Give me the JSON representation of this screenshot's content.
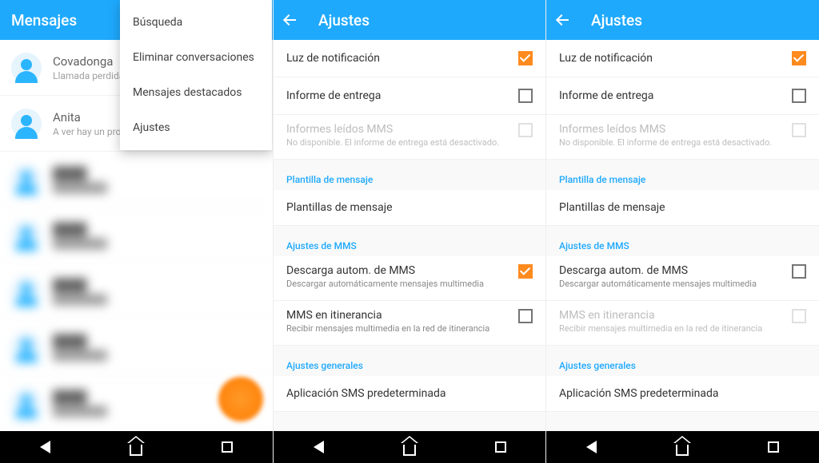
{
  "panel1": {
    "title": "Mensajes",
    "menu": [
      "Búsqueda",
      "Eliminar conversaciones",
      "Mensajes destacados",
      "Ajustes"
    ],
    "conversations": [
      {
        "name": "Covadonga",
        "sub": "Llamada perdida"
      },
      {
        "name": "Anita",
        "sub": "A ver hay un problema"
      }
    ]
  },
  "settings_title": "Ajustes",
  "rows": {
    "luz": "Luz de notificación",
    "informe": "Informe de entrega",
    "informes_mms_t": "Informes leídos MMS",
    "informes_mms_s": "No disponible. El informe de entrega está desactivado.",
    "plantilla_h": "Plantilla de mensaje",
    "plantillas": "Plantillas de mensaje",
    "mms_h": "Ajustes de MMS",
    "descarga_t": "Descarga autom. de MMS",
    "descarga_s": "Descargar automáticamente mensajes multimedia",
    "roaming_t": "MMS en itinerancia",
    "roaming_s": "Recibir mensajes multimedia en la red de itinerancia",
    "general_h": "Ajustes generales",
    "sms_app": "Aplicación SMS predeterminada"
  },
  "p2_checks": {
    "luz": true,
    "informe": false,
    "descarga": true,
    "roaming": false
  },
  "p3_checks": {
    "luz": true,
    "informe": false,
    "descarga": false,
    "roaming": false
  }
}
